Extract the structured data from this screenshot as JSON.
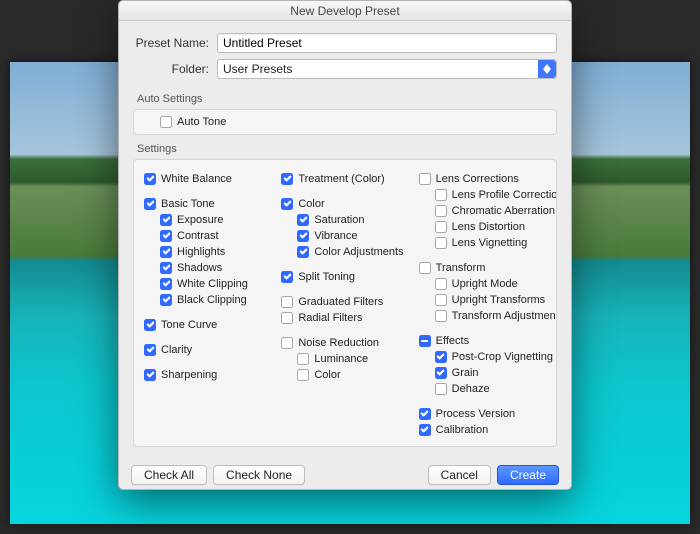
{
  "dialog": {
    "title": "New Develop Preset"
  },
  "fields": {
    "preset_label": "Preset Name:",
    "preset_value": "Untitled Preset",
    "folder_label": "Folder:",
    "folder_value": "User Presets"
  },
  "sections": {
    "auto": "Auto Settings",
    "settings": "Settings"
  },
  "auto": {
    "tone": "Auto Tone"
  },
  "col1": {
    "white_balance": "White Balance",
    "basic_tone": "Basic Tone",
    "exposure": "Exposure",
    "contrast": "Contrast",
    "highlights": "Highlights",
    "shadows": "Shadows",
    "white_clip": "White Clipping",
    "black_clip": "Black Clipping",
    "tone_curve": "Tone Curve",
    "clarity": "Clarity",
    "sharpening": "Sharpening"
  },
  "col2": {
    "treatment": "Treatment (Color)",
    "color": "Color",
    "saturation": "Saturation",
    "vibrance": "Vibrance",
    "color_adj": "Color Adjustments",
    "split_toning": "Split Toning",
    "grad_filters": "Graduated Filters",
    "radial_filters": "Radial Filters",
    "noise_reduction": "Noise Reduction",
    "luminance": "Luminance",
    "nr_color": "Color"
  },
  "col3": {
    "lens_corr": "Lens Corrections",
    "lens_profile": "Lens Profile Corrections",
    "chrom_ab": "Chromatic Aberration",
    "lens_dist": "Lens Distortion",
    "lens_vig": "Lens Vignetting",
    "transform": "Transform",
    "upright_mode": "Upright Mode",
    "upright_trans": "Upright Transforms",
    "trans_adj": "Transform Adjustments",
    "effects": "Effects",
    "post_crop": "Post-Crop Vignetting",
    "grain": "Grain",
    "dehaze": "Dehaze",
    "proc_ver": "Process Version",
    "calibration": "Calibration"
  },
  "buttons": {
    "check_all": "Check All",
    "check_none": "Check None",
    "cancel": "Cancel",
    "create": "Create"
  }
}
